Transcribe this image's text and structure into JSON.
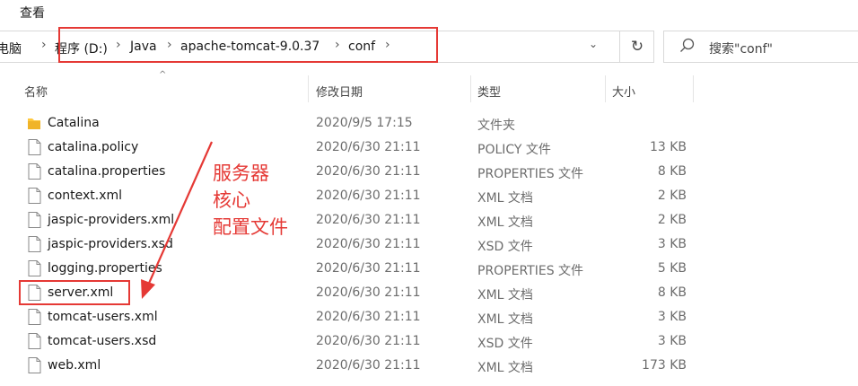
{
  "menu": {
    "view_label": "查看"
  },
  "address": {
    "crumbs": [
      "电脑",
      "程序 (D:)",
      "Java",
      "apache-tomcat-9.0.37",
      "conf"
    ],
    "refresh_icon": "refresh-icon"
  },
  "search": {
    "placeholder": "搜索\"conf\""
  },
  "columns": {
    "name": "名称",
    "date": "修改日期",
    "type": "类型",
    "size": "大小"
  },
  "files": [
    {
      "name": "Catalina",
      "date": "2020/9/5 17:15",
      "type": "文件夹",
      "size": "",
      "icon": "folder-icon"
    },
    {
      "name": "catalina.policy",
      "date": "2020/6/30 21:11",
      "type": "POLICY 文件",
      "size": "13 KB",
      "icon": "file-icon"
    },
    {
      "name": "catalina.properties",
      "date": "2020/6/30 21:11",
      "type": "PROPERTIES 文件",
      "size": "8 KB",
      "icon": "file-icon"
    },
    {
      "name": "context.xml",
      "date": "2020/6/30 21:11",
      "type": "XML 文档",
      "size": "2 KB",
      "icon": "file-icon"
    },
    {
      "name": "jaspic-providers.xml",
      "date": "2020/6/30 21:11",
      "type": "XML 文档",
      "size": "2 KB",
      "icon": "file-icon"
    },
    {
      "name": "jaspic-providers.xsd",
      "date": "2020/6/30 21:11",
      "type": "XSD 文件",
      "size": "3 KB",
      "icon": "file-icon"
    },
    {
      "name": "logging.properties",
      "date": "2020/6/30 21:11",
      "type": "PROPERTIES 文件",
      "size": "5 KB",
      "icon": "file-icon"
    },
    {
      "name": "server.xml",
      "date": "2020/6/30 21:11",
      "type": "XML 文档",
      "size": "8 KB",
      "icon": "file-icon"
    },
    {
      "name": "tomcat-users.xml",
      "date": "2020/6/30 21:11",
      "type": "XML 文档",
      "size": "3 KB",
      "icon": "file-icon"
    },
    {
      "name": "tomcat-users.xsd",
      "date": "2020/6/30 21:11",
      "type": "XSD 文件",
      "size": "3 KB",
      "icon": "file-icon"
    },
    {
      "name": "web.xml",
      "date": "2020/6/30 21:11",
      "type": "XML 文档",
      "size": "173 KB",
      "icon": "file-icon"
    }
  ],
  "annotation": {
    "lines": [
      "服务器",
      "核心",
      "配置文件"
    ],
    "color": "#e53935"
  }
}
